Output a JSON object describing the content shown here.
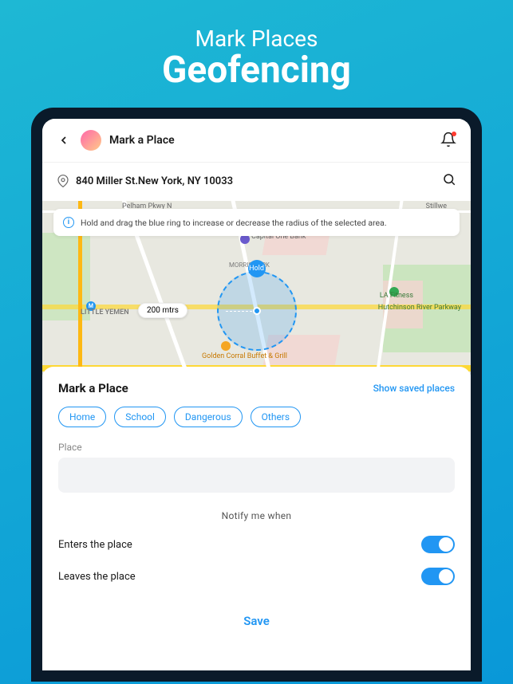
{
  "promo": {
    "sub": "Mark Places",
    "title": "Geofencing"
  },
  "header": {
    "title": "Mark a Place"
  },
  "address": "840 Miller St.New York, NY 10033",
  "hint": "Hold and drag the blue ring to increase or decrease the radius of the selected area.",
  "hold_label": "Hold",
  "distance": "200 mtrs",
  "map": {
    "road_top": "Pelham Pkwy N",
    "neighborhood_left": "LITTLE YEMEN",
    "park_center": "MORRIS PARK",
    "poi_bank": "Capital One Bank",
    "poi_gym": "LA Fitness",
    "poi_food": "Golden Corral Buffet & Grill",
    "park_right": "Hutchinson River Parkway",
    "label_stillwe": "Stillwe",
    "metro": "M"
  },
  "sheet": {
    "title": "Mark a Place",
    "show_saved": "Show saved places",
    "chips": [
      "Home",
      "School",
      "Dangerous",
      "Others"
    ],
    "place_label": "Place",
    "place_value": "",
    "notify_header": "Notify me when",
    "enters": "Enters the place",
    "leaves": "Leaves the place",
    "save": "Save"
  }
}
